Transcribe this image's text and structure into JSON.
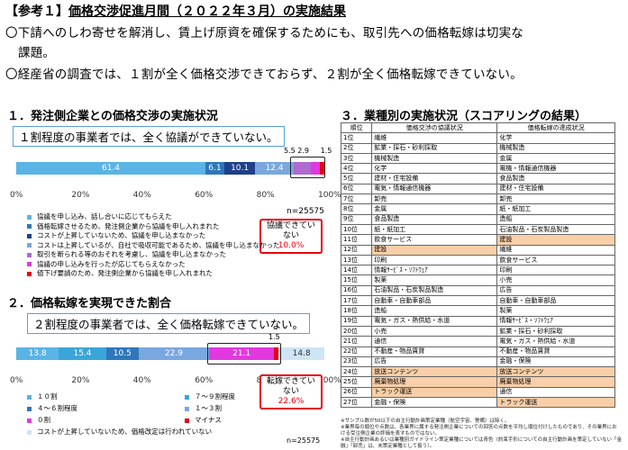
{
  "title": {
    "prefix": "【参考１】",
    "main": "価格交渉促進月間（２０２２年３月）の実施結果"
  },
  "para1": {
    "line1": "〇下請へのしわ寄せを解消し、賃上げ原資を確保するためにも、取引先への価格転嫁は切実な",
    "line2": "課題。"
  },
  "para2": "〇経産省の調査では、１割が全く価格交渉できておらず、２割が全く価格転嫁できていない。",
  "section1": {
    "heading": "１．発注側企業との価格交渉の実施状況",
    "callout": "１割程度の事業者では、全く協議ができていない。",
    "top_labels": [
      "5.5",
      "2.9",
      "1.5"
    ],
    "axis": [
      "0%",
      "20%",
      "40%",
      "60%",
      "80%",
      "100%"
    ],
    "n": "n=25575",
    "redbox": {
      "text": "協議できていない",
      "pct": "10.0%"
    },
    "legend": [
      {
        "label": "協議を申し込み、話し合いに応じてもらえた",
        "color": "#5ab4e5"
      },
      {
        "label": "価格転嫁させるため、発注側企業から協議を申し入れまれた",
        "color": "#2e77bb"
      },
      {
        "label": "コストが上昇していないため、協議を申し込まなかった",
        "color": "#1f3f8a"
      },
      {
        "label": "コストは上昇しているが、自社で吸収可能であるため、協議を申し込まなかった",
        "color": "#7aa7e0"
      },
      {
        "label": "取引を断られる等のおそれを考慮し、協議を申し込まなかった",
        "color": "#b06ad0"
      },
      {
        "label": "協議の申し込みを行ったが応じてもらえなかった",
        "color": "#e238e0"
      },
      {
        "label": "値下げ要請のため、発注側企業から協議を申し入れまれた",
        "color": "#e60012"
      }
    ]
  },
  "section2": {
    "heading": "２．価格転嫁を実現できた割合",
    "callout": "２割程度の事業者では、全く価格転嫁できていない。",
    "top_label": "1.5",
    "axis": [
      "0%",
      "20%",
      "40%",
      "60%",
      "80%",
      "100%"
    ],
    "n": "n=25575",
    "redbox": {
      "text": "転嫁できていない",
      "pct": "22.6%"
    },
    "legend": [
      {
        "label": "１０割",
        "color": "#5ab4e5"
      },
      {
        "label": "７～９割程度",
        "color": "#3aa5d8"
      },
      {
        "label": "４～６割程度",
        "color": "#2e77bb"
      },
      {
        "label": "１～３割",
        "color": "#7aa7e0"
      },
      {
        "label": "０割",
        "color": "#e238e0"
      },
      {
        "label": "マイナス",
        "color": "#e60012"
      },
      {
        "label": "コストが上昇していないため、価格改定は行われていない",
        "color": "#cde5f5"
      }
    ]
  },
  "chart_data": [
    {
      "type": "bar",
      "title": "発注側企業との価格交渉の実施状況",
      "orientation": "horizontal-stacked",
      "values": [
        61.4,
        6.1,
        10.1,
        12.4,
        5.5,
        2.9,
        1.5
      ],
      "labels": [
        "61.4",
        "6.1",
        "10.1",
        "12.4",
        "",
        "",
        ""
      ],
      "colors": [
        "#5ab4e5",
        "#2e77bb",
        "#1f3f8a",
        "#7aa7e0",
        "#b06ad0",
        "#e238e0",
        "#e60012"
      ],
      "xlim": [
        0,
        100
      ]
    },
    {
      "type": "bar",
      "title": "価格転嫁を実現できた割合",
      "orientation": "horizontal-stacked",
      "values": [
        13.8,
        15.4,
        10.5,
        22.9,
        21.1,
        1.5,
        14.8
      ],
      "labels": [
        "13.8",
        "15.4",
        "10.5",
        "22.9",
        "21.1",
        "",
        "14.8"
      ],
      "colors": [
        "#5ab4e5",
        "#3aa5d8",
        "#2e77bb",
        "#7aa7e0",
        "#e238e0",
        "#e60012",
        "#cde5f5"
      ],
      "xlim": [
        0,
        100
      ]
    }
  ],
  "section3": {
    "heading": "３．業種別の実施状況（スコアリングの結果）",
    "headers": [
      "順位",
      "価格交渉の協議状況",
      "価格転嫁の達成状況"
    ],
    "rows": [
      {
        "rank": "1位",
        "a": "繊維",
        "b": "化学",
        "ha": false,
        "hb": false
      },
      {
        "rank": "2位",
        "a": "鉱業・採石・砂利採取",
        "b": "機械製造",
        "ha": false,
        "hb": false
      },
      {
        "rank": "3位",
        "a": "機械製造",
        "b": "金属",
        "ha": false,
        "hb": false
      },
      {
        "rank": "4位",
        "a": "化学",
        "b": "電機・情報通信機器",
        "ha": false,
        "hb": false
      },
      {
        "rank": "5位",
        "a": "建材・住宅設備",
        "b": "食品製造",
        "ha": false,
        "hb": false
      },
      {
        "rank": "6位",
        "a": "電気・情報通信機器",
        "b": "建材・住宅設備",
        "ha": false,
        "hb": false
      },
      {
        "rank": "7位",
        "a": "卸売",
        "b": "卸売",
        "ha": false,
        "hb": false
      },
      {
        "rank": "8位",
        "a": "金属",
        "b": "紙・紙加工",
        "ha": false,
        "hb": false
      },
      {
        "rank": "9位",
        "a": "食品製造",
        "b": "造船",
        "ha": false,
        "hb": false
      },
      {
        "rank": "10位",
        "a": "紙・紙加工",
        "b": "石油製品・石炭製品製造",
        "ha": false,
        "hb": false
      },
      {
        "rank": "11位",
        "a": "飲食サービス",
        "b": "建設",
        "ha": false,
        "hb": true
      },
      {
        "rank": "12位",
        "a": "建設",
        "b": "繊維",
        "ha": true,
        "hb": false
      },
      {
        "rank": "13位",
        "a": "印刷",
        "b": "飲食サービス",
        "ha": false,
        "hb": false
      },
      {
        "rank": "14位",
        "a": "情報ｻｰﾋﾞｽ・ｿﾌﾄｳｪｱ",
        "b": "印刷",
        "ha": false,
        "hb": false
      },
      {
        "rank": "15位",
        "a": "製薬",
        "b": "小売",
        "ha": false,
        "hb": false
      },
      {
        "rank": "16位",
        "a": "石油製品・石炭製品製造",
        "b": "広告",
        "ha": false,
        "hb": false
      },
      {
        "rank": "17位",
        "a": "自動車・自動車部品",
        "b": "自動車・自動車部品",
        "ha": false,
        "hb": false
      },
      {
        "rank": "18位",
        "a": "造船",
        "b": "製薬",
        "ha": false,
        "hb": false
      },
      {
        "rank": "19位",
        "a": "電気・ガス・熱供給・水道",
        "b": "情報ｻｰﾋﾞｽ・ｿﾌﾄｳｪｱ",
        "ha": false,
        "hb": false
      },
      {
        "rank": "20位",
        "a": "小売",
        "b": "鉱業・採石・砂利採取",
        "ha": false,
        "hb": false
      },
      {
        "rank": "21位",
        "a": "通信",
        "b": "電気・ガス・熱供給・水道",
        "ha": false,
        "hb": false
      },
      {
        "rank": "22位",
        "a": "不動産・物品賃貸",
        "b": "不動産・物品賃貸",
        "ha": false,
        "hb": false
      },
      {
        "rank": "23位",
        "a": "広告",
        "b": "金融・保険",
        "ha": false,
        "hb": false
      },
      {
        "rank": "24位",
        "a": "放送コンテンツ",
        "b": "放送コンテンツ",
        "ha": true,
        "hb": true
      },
      {
        "rank": "25位",
        "a": "廃棄物処理",
        "b": "廃棄物処理",
        "ha": true,
        "hb": true
      },
      {
        "rank": "26位",
        "a": "トラック運送",
        "b": "通信",
        "ha": true,
        "hb": false
      },
      {
        "rank": "27位",
        "a": "金融・保険",
        "b": "トラック運送",
        "ha": false,
        "hb": true
      }
    ],
    "footnotes": [
      "※サンプル数が50以下の自主行動計画策定業種（航空宇宙、警備）は除く。",
      "※業界毎の順位や点数は、各業界に属する発注側企業についての回答の点数を平均し順位付けしたものであり、その業界における受注側企業の評価を表すものではない。",
      "※自主行動計画あるいは業種別ガイドライン策定業種については青色（約束手形についての自主行動計画を策定していない「金融」「卸売」は、未策定業種として扱う）。"
    ]
  }
}
